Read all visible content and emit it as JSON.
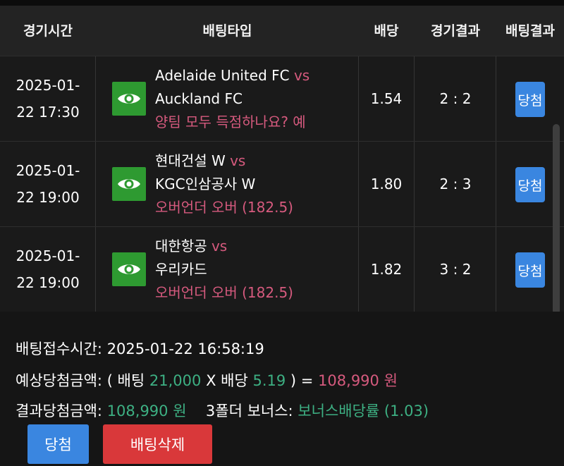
{
  "header": {
    "col_time": "경기시간",
    "col_type": "배팅타입",
    "col_odds": "배당",
    "col_result": "경기결과",
    "col_bet_result": "배팅결과"
  },
  "rows": [
    {
      "date": "2025-01-",
      "time": "22 17:30",
      "home": "Adelaide United FC",
      "vs": "vs",
      "away": "Auckland FC",
      "bet": "양팀 모두 득점하나요? 예",
      "odds": "1.54",
      "score": "2 : 2",
      "result": "당첨"
    },
    {
      "date": "2025-01-",
      "time": "22 19:00",
      "home": "현대건설 W",
      "vs": "vs",
      "away": "KGC인삼공사 W",
      "bet": "오버언더 오버 (182.5)",
      "odds": "1.80",
      "score": "2 : 3",
      "result": "당첨"
    },
    {
      "date": "2025-01-",
      "time": "22 19:00",
      "home": "대한항공",
      "vs": "vs",
      "away": "우리카드",
      "bet": "오버언더 오버 (182.5)",
      "odds": "1.82",
      "score": "3 : 2",
      "result": "당첨"
    }
  ],
  "summary": {
    "received_label": "배팅접수시간:",
    "received_value": "2025-01-22 16:58:19",
    "expected_label": "예상당첨금액:",
    "expected_open": "( 배팅",
    "stake": "21,000",
    "times": "X 배당",
    "total_odds": "5.19",
    "close_eq": ") =",
    "expected_amount": "108,990 원",
    "final_label": "결과당첨금액:",
    "final_amount": "108,990 원",
    "bonus_label": "3폴더 보너스:",
    "bonus_value": "보너스배당률 (1.03)"
  },
  "buttons": {
    "win": "당첨",
    "delete": "배팅삭제"
  },
  "colors": {
    "accent_pink": "#d65a7e",
    "accent_green": "#3db083",
    "win_blue": "#3a86e0",
    "delete_red": "#d9383a",
    "eye_green": "#2e9a31"
  },
  "icons": {
    "view": "eye-icon"
  }
}
